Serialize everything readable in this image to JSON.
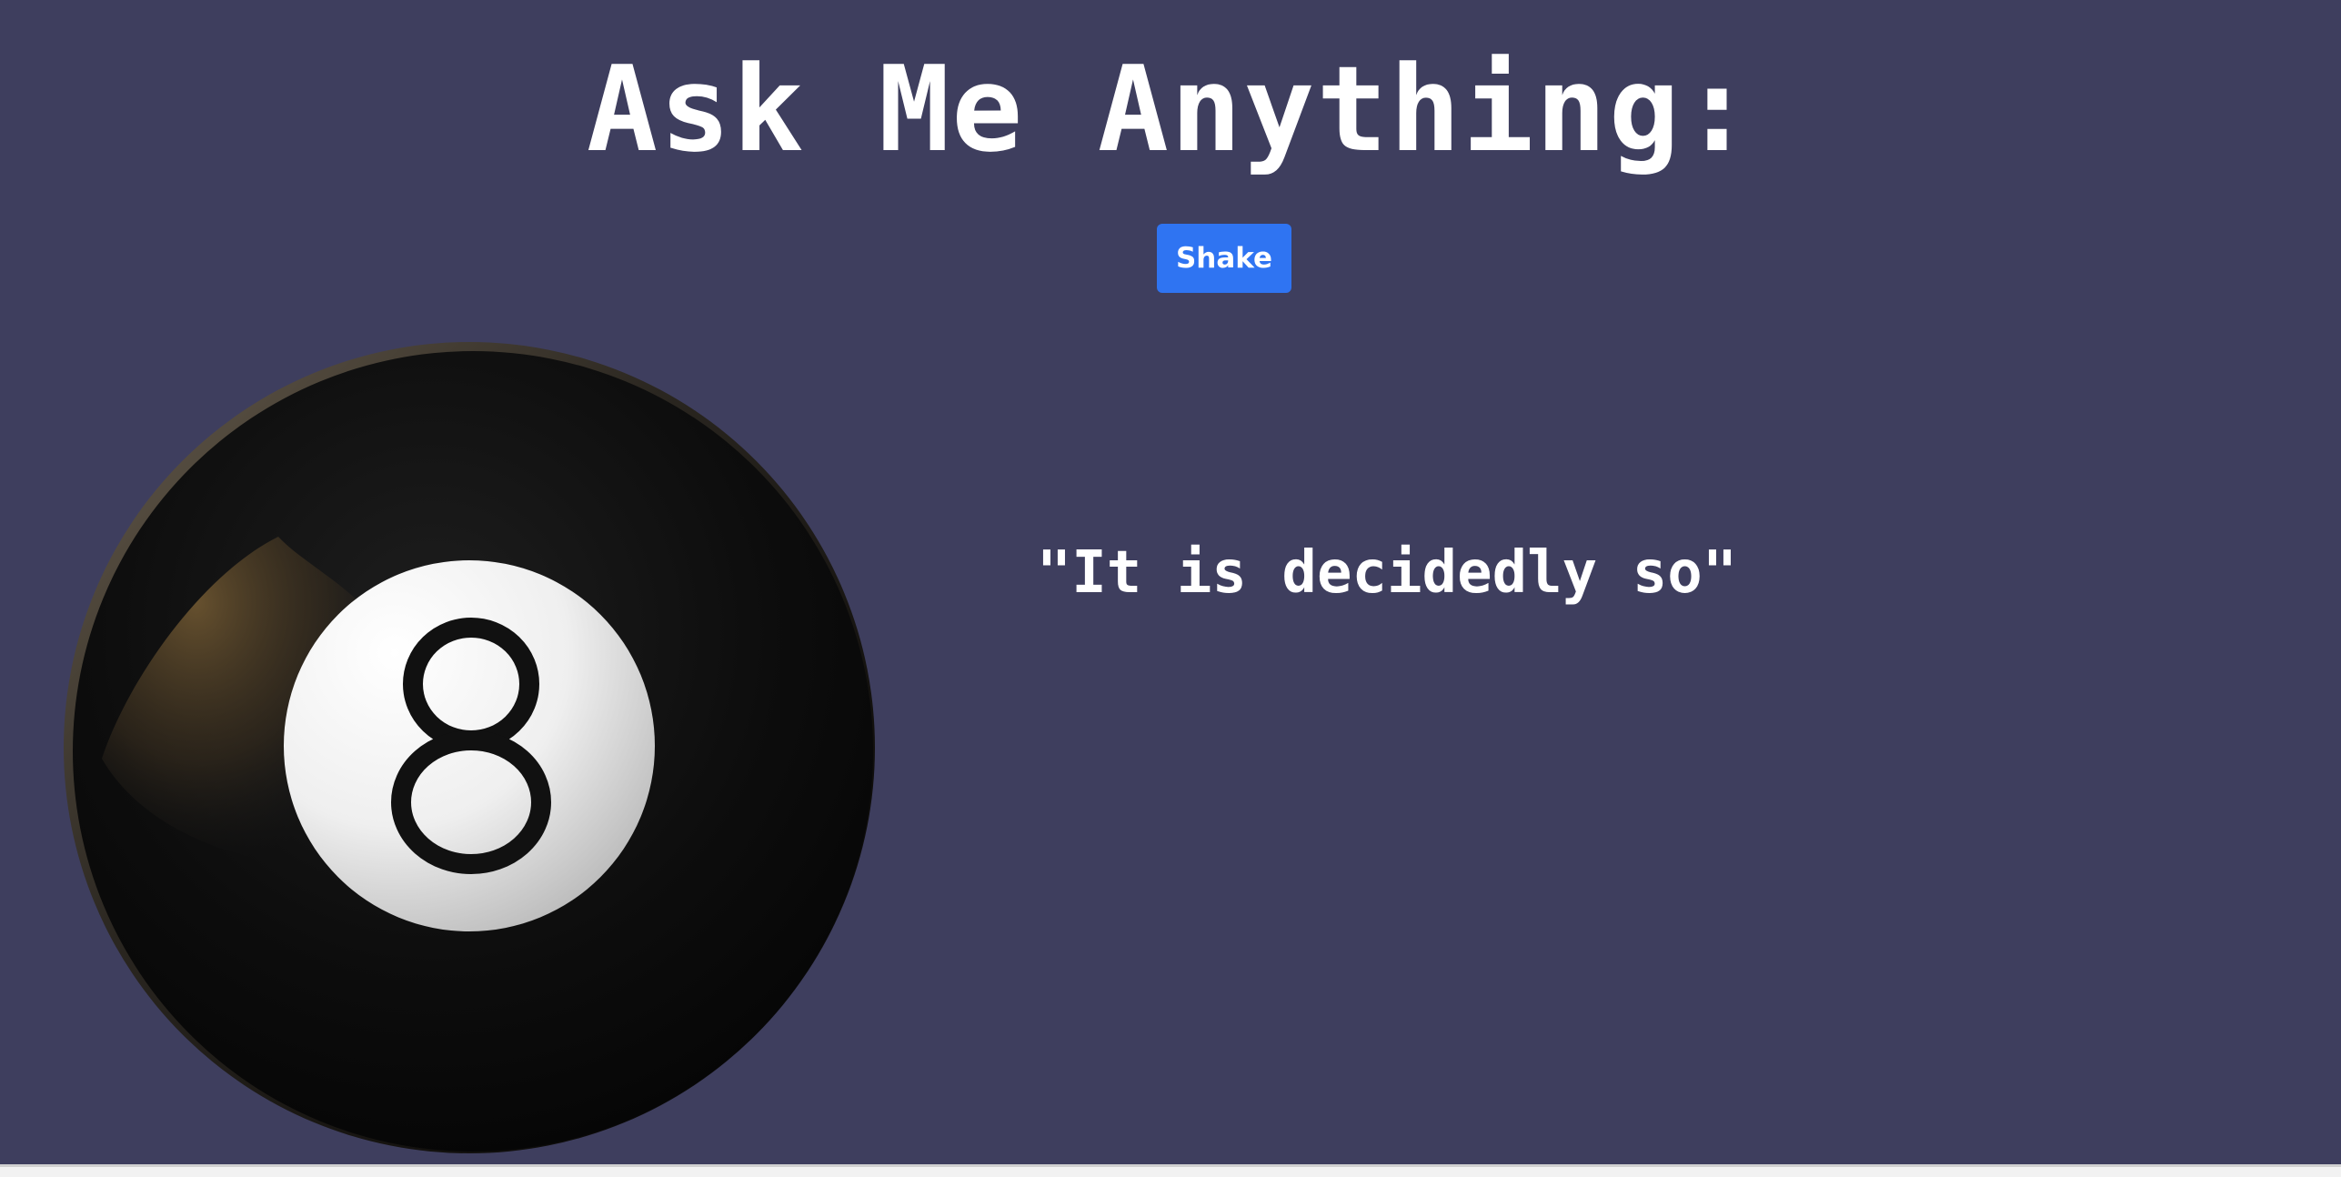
{
  "header": {
    "title": "Ask Me Anything:"
  },
  "controls": {
    "shake_label": "Shake"
  },
  "ball": {
    "icon": "magic-8-ball-icon",
    "number": "8",
    "colors": {
      "body": "#0a0a0a",
      "rim": "#5a5045",
      "highlight": "#6b5430",
      "face": "#ffffff"
    }
  },
  "answer": {
    "text": "\"It is decidedly so\""
  },
  "theme": {
    "background": "#3e3e5e",
    "button": "#2f74f2",
    "text": "#ffffff"
  }
}
